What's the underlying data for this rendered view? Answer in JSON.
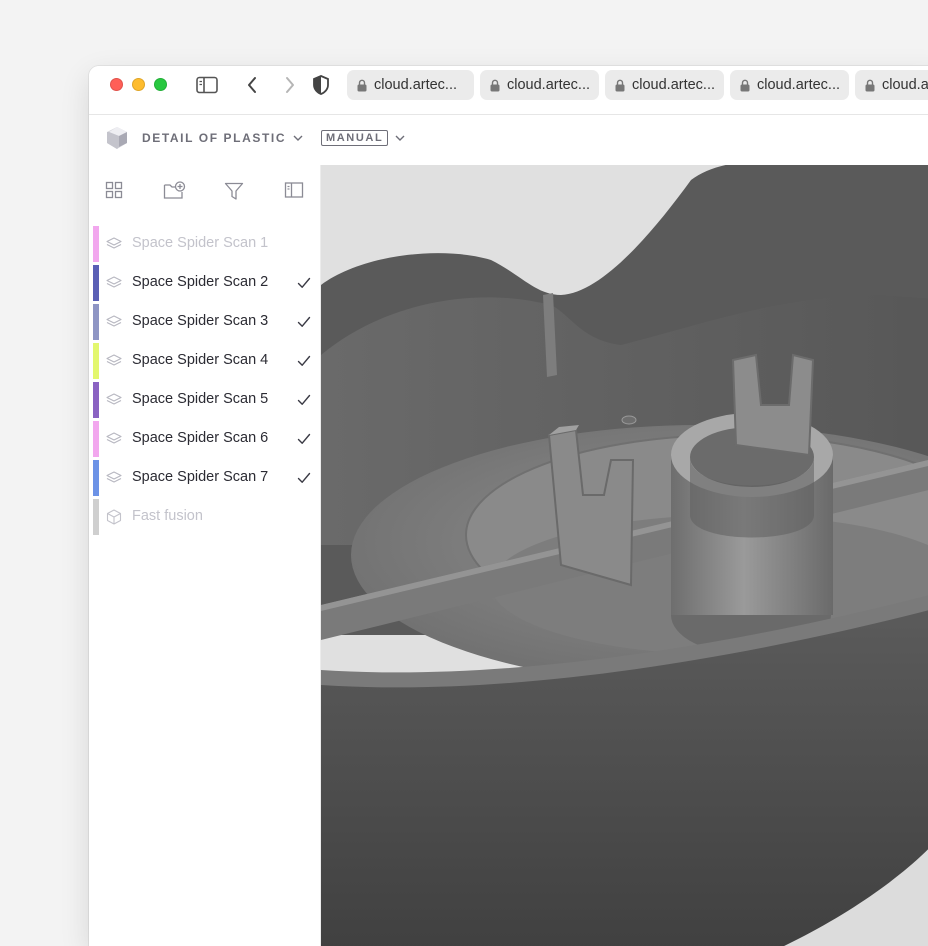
{
  "browser": {
    "tabs": [
      {
        "title": "cloud.artec..."
      },
      {
        "title": "cloud.artec..."
      },
      {
        "title": "cloud.artec..."
      },
      {
        "title": "cloud.artec..."
      },
      {
        "title": "cloud.a"
      }
    ]
  },
  "app": {
    "project_name": "DETAIL OF PLASTIC",
    "mode": "MANUAL"
  },
  "sidebar": {
    "items": [
      {
        "label": "Space Spider Scan 1",
        "color": "#f2a7ee",
        "checked": false,
        "dim": true,
        "icon": "layers-icon"
      },
      {
        "label": "Space Spider Scan 2",
        "color": "#5a5fb5",
        "checked": true,
        "dim": false,
        "icon": "layers-icon"
      },
      {
        "label": "Space Spider Scan 3",
        "color": "#8e95c4",
        "checked": true,
        "dim": false,
        "icon": "layers-icon"
      },
      {
        "label": "Space Spider Scan 4",
        "color": "#e3f76e",
        "checked": true,
        "dim": false,
        "icon": "layers-icon"
      },
      {
        "label": "Space Spider Scan 5",
        "color": "#8a62c2",
        "checked": true,
        "dim": false,
        "icon": "layers-icon"
      },
      {
        "label": "Space Spider Scan 6",
        "color": "#f2a7ee",
        "checked": true,
        "dim": false,
        "icon": "layers-icon"
      },
      {
        "label": "Space Spider Scan 7",
        "color": "#6c92e6",
        "checked": true,
        "dim": false,
        "icon": "layers-icon"
      },
      {
        "label": "Fast fusion",
        "color": "#cfcfcf",
        "checked": false,
        "dim": true,
        "icon": "cube-icon"
      }
    ]
  },
  "colors": {
    "accent_text": "#2b2b33",
    "dim_text": "#c3c3cb",
    "viewport_bg": "#e0e0e0",
    "model": "#4d4d4d"
  }
}
